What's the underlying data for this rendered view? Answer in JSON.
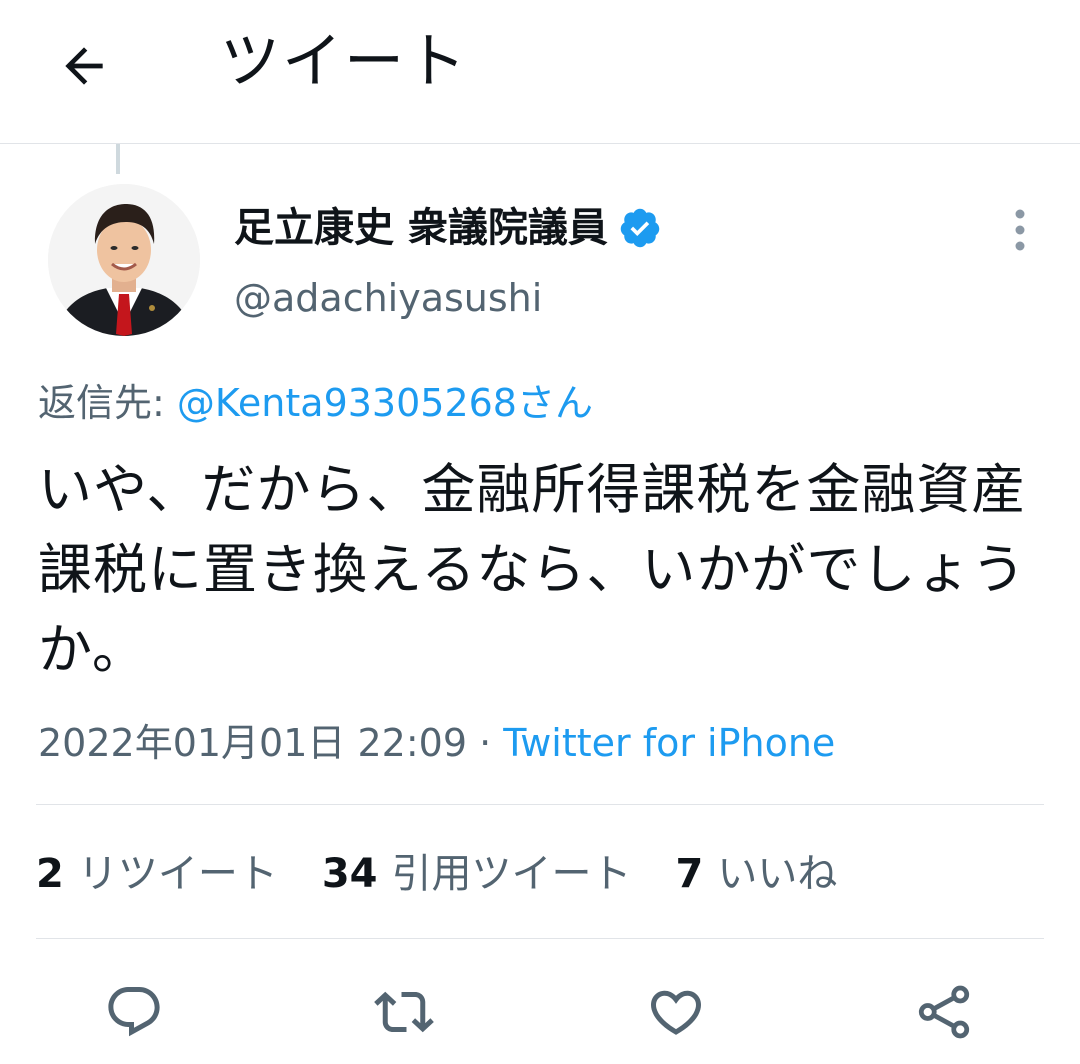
{
  "header": {
    "back_icon": "arrow-left-icon",
    "title": "ツイート"
  },
  "author": {
    "name": "足立康史 衆議院議員",
    "verified_icon": "verified-badge-icon",
    "handle": "@adachiyasushi"
  },
  "reply": {
    "prefix": "返信先: ",
    "mention": "@Kenta93305268さん"
  },
  "tweet": {
    "text": "いや、だから、金融所得課税を金融資産課税に置き換えるなら、いかがでしょうか。",
    "datetime": "2022年01月01日 22:09",
    "separator": " · ",
    "source": "Twitter for iPhone"
  },
  "stats": {
    "retweets_count": "2",
    "retweets_label": "リツイート",
    "quotes_count": "34",
    "quotes_label": "引用ツイート",
    "likes_count": "7",
    "likes_label": "いいね"
  },
  "actions": {
    "reply_icon": "reply-icon",
    "retweet_icon": "retweet-icon",
    "like_icon": "heart-icon",
    "share_icon": "share-icon"
  },
  "colors": {
    "accent": "#1d9bf0",
    "text": "#0f1419",
    "secondary_text": "#536471",
    "divider": "#e1e4e8"
  }
}
